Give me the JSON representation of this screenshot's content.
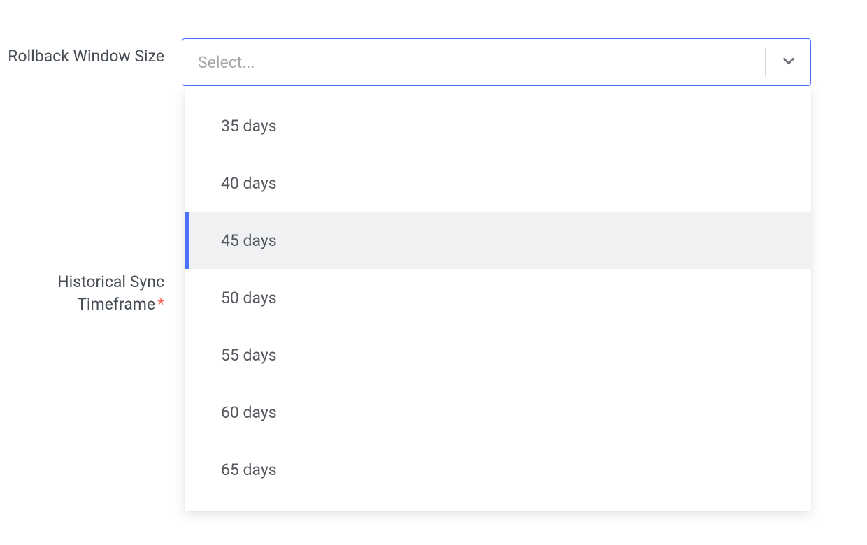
{
  "fields": {
    "rollback": {
      "label": "Rollback Window Size",
      "placeholder": "Select...",
      "required": false,
      "options": [
        {
          "label": "35 days",
          "highlighted": false
        },
        {
          "label": "40 days",
          "highlighted": false
        },
        {
          "label": "45 days",
          "highlighted": true
        },
        {
          "label": "50 days",
          "highlighted": false
        },
        {
          "label": "55 days",
          "highlighted": false
        },
        {
          "label": "60 days",
          "highlighted": false
        },
        {
          "label": "65 days",
          "highlighted": false
        }
      ]
    },
    "historical": {
      "label": "Historical Sync Timeframe",
      "required": true
    }
  },
  "asterisk": "*"
}
